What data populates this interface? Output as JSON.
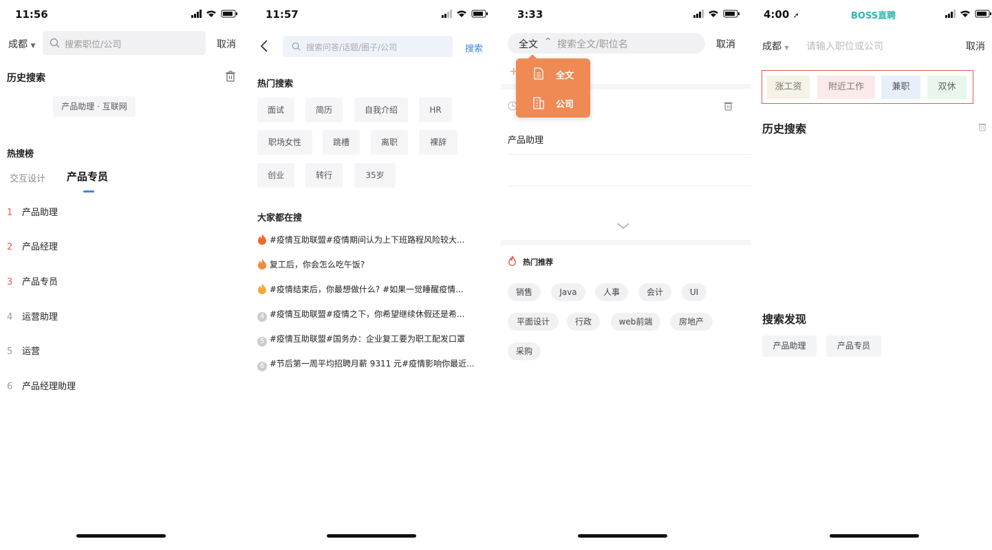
{
  "screen1": {
    "time": "11:56",
    "city": "成都",
    "search_placeholder": "搜索职位/公司",
    "cancel": "取消",
    "history_title": "历史搜索",
    "history_chip": "产品助理 · 互联网",
    "hot_title": "热搜榜",
    "tabs": [
      "交互设计",
      "产品专员"
    ],
    "ranks": [
      {
        "num": "1",
        "label": "产品助理"
      },
      {
        "num": "2",
        "label": "产品经理"
      },
      {
        "num": "3",
        "label": "产品专员"
      },
      {
        "num": "4",
        "label": "运营助理"
      },
      {
        "num": "5",
        "label": "运营"
      },
      {
        "num": "6",
        "label": "产品经理助理"
      }
    ]
  },
  "screen2": {
    "time": "11:57",
    "search_placeholder": "搜索问答/话题/圈子/公司",
    "search_btn": "搜索",
    "hot_title": "热门搜索",
    "hot_chips": [
      "面试",
      "简历",
      "自我介绍",
      "HR",
      "职场女性",
      "跳槽",
      "离职",
      "裸辞",
      "创业",
      "转行",
      "35岁"
    ],
    "all_title": "大家都在搜",
    "topics": [
      {
        "badge": "fire",
        "text": "#疫情互助联盟#疫情期间认为上下班路程风险较大..."
      },
      {
        "badge": "fire",
        "text": "复工后，你会怎么吃午饭?"
      },
      {
        "badge": "fire",
        "text": "#疫情结束后，你最想做什么? #如果一觉睡醒疫情..."
      },
      {
        "badge": "4",
        "text": "#疫情互助联盟#疫情之下，你希望继续休假还是希..."
      },
      {
        "badge": "5",
        "text": "#疫情互助联盟#国务办：企业复工要为职工配发口罩"
      },
      {
        "badge": "6",
        "text": "#节后第一周平均招聘月薪 9311 元#疫情影响你最近..."
      }
    ],
    "colors": {
      "fire": "#f06a2a",
      "accent": "#3b86e6"
    }
  },
  "screen3": {
    "time": "3:33",
    "scope": "全文",
    "search_placeholder": "搜索全文/职位名",
    "cancel": "取消",
    "dropdown": [
      {
        "icon": "document-icon",
        "label": "全文"
      },
      {
        "icon": "building-icon",
        "label": "公司"
      }
    ],
    "history_item": "产品助理",
    "hot_title": "热门推荐",
    "hot_pills": [
      "销售",
      "Java",
      "人事",
      "会计",
      "UI",
      "平面设计",
      "行政",
      "web前端",
      "房地产",
      "采购"
    ],
    "colors": {
      "dropdown": "#ef8a55"
    }
  },
  "screen4": {
    "time": "4:00",
    "brand": "BOSS直聘",
    "city": "成都",
    "search_placeholder": "请输入职位或公司",
    "cancel": "取消",
    "tags": [
      "涨工资",
      "附近工作",
      "兼职",
      "双休"
    ],
    "history_title": "历史搜索",
    "discover_title": "搜索发现",
    "discover_chips": [
      "产品助理",
      "产品专员"
    ],
    "colors": {
      "brand": "#2ab7b0",
      "highlight_border": "#e0574a"
    }
  }
}
